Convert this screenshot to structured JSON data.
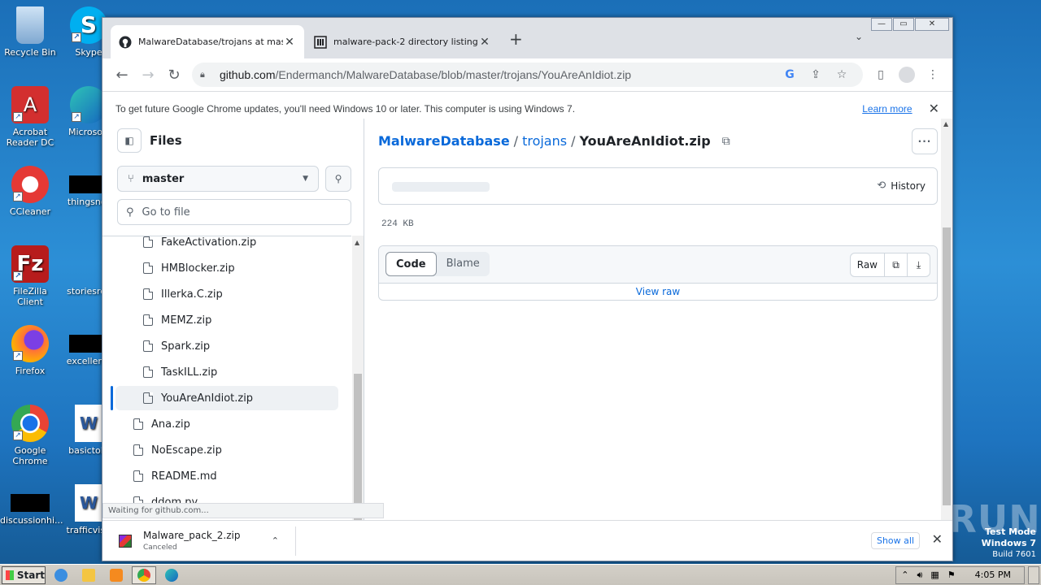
{
  "desktop": {
    "icons": [
      {
        "label": "Recycle Bin"
      },
      {
        "label": "Skype"
      },
      {
        "label": "Acrobat Reader DC"
      },
      {
        "label": "Microsoft"
      },
      {
        "label": "CCleaner"
      },
      {
        "label": "thingsnor"
      },
      {
        "label": "FileZilla Client"
      },
      {
        "label": "storiesres"
      },
      {
        "label": "Firefox"
      },
      {
        "label": "excellentr"
      },
      {
        "label": "Google Chrome"
      },
      {
        "label": "basictold"
      },
      {
        "label": "discussionhi..."
      },
      {
        "label": "trafficvisit"
      }
    ],
    "watermark": "ANY RUN",
    "test_mode": {
      "line1": "Test Mode",
      "line2": "Windows 7",
      "line3": "Build 7601"
    }
  },
  "browser": {
    "tabs": [
      {
        "title": "MalwareDatabase/trojans at master",
        "icon": "github-icon"
      },
      {
        "title": "malware-pack-2 directory listing",
        "icon": "bank-icon"
      }
    ],
    "url_host": "github.com",
    "url_path": "/Endermanch/MalwareDatabase/blob/master/trojans/YouAreAnIdiot.zip",
    "infobar": {
      "message": "To get future Google Chrome updates, you'll need Windows 10 or later. This computer is using Windows 7.",
      "link": "Learn more"
    },
    "status_text": "Waiting for github.com...",
    "download": {
      "name": "Malware_pack_2.zip",
      "status": "Canceled",
      "show_all": "Show all"
    }
  },
  "github": {
    "sidebar": {
      "title": "Files",
      "branch": "master",
      "go_to_file_placeholder": "Go to file",
      "tree": [
        {
          "name": "FakeActivation.zip",
          "indent": 2,
          "selected": false
        },
        {
          "name": "HMBlocker.zip",
          "indent": 2,
          "selected": false
        },
        {
          "name": "Illerka.C.zip",
          "indent": 2,
          "selected": false
        },
        {
          "name": "MEMZ.zip",
          "indent": 2,
          "selected": false
        },
        {
          "name": "Spark.zip",
          "indent": 2,
          "selected": false
        },
        {
          "name": "TaskILL.zip",
          "indent": 2,
          "selected": false
        },
        {
          "name": "YouAreAnIdiot.zip",
          "indent": 2,
          "selected": true
        },
        {
          "name": "Ana.zip",
          "indent": 1,
          "selected": false
        },
        {
          "name": "NoEscape.zip",
          "indent": 1,
          "selected": false
        },
        {
          "name": "README.md",
          "indent": 1,
          "selected": false
        },
        {
          "name": "ddom.py",
          "indent": 1,
          "selected": false
        }
      ]
    },
    "breadcrumb": {
      "repo": "MalwareDatabase",
      "folder": "trojans",
      "file": "YouAreAnIdiot.zip"
    },
    "history_label": "History",
    "file_size": "224 KB",
    "tabs": {
      "code": "Code",
      "blame": "Blame"
    },
    "raw_label": "Raw",
    "view_raw": "View raw"
  },
  "taskbar": {
    "start": "Start",
    "clock": "4:05 PM"
  },
  "colors": {
    "accent": "#0969da",
    "chrome_blue": "#1a73e8"
  }
}
